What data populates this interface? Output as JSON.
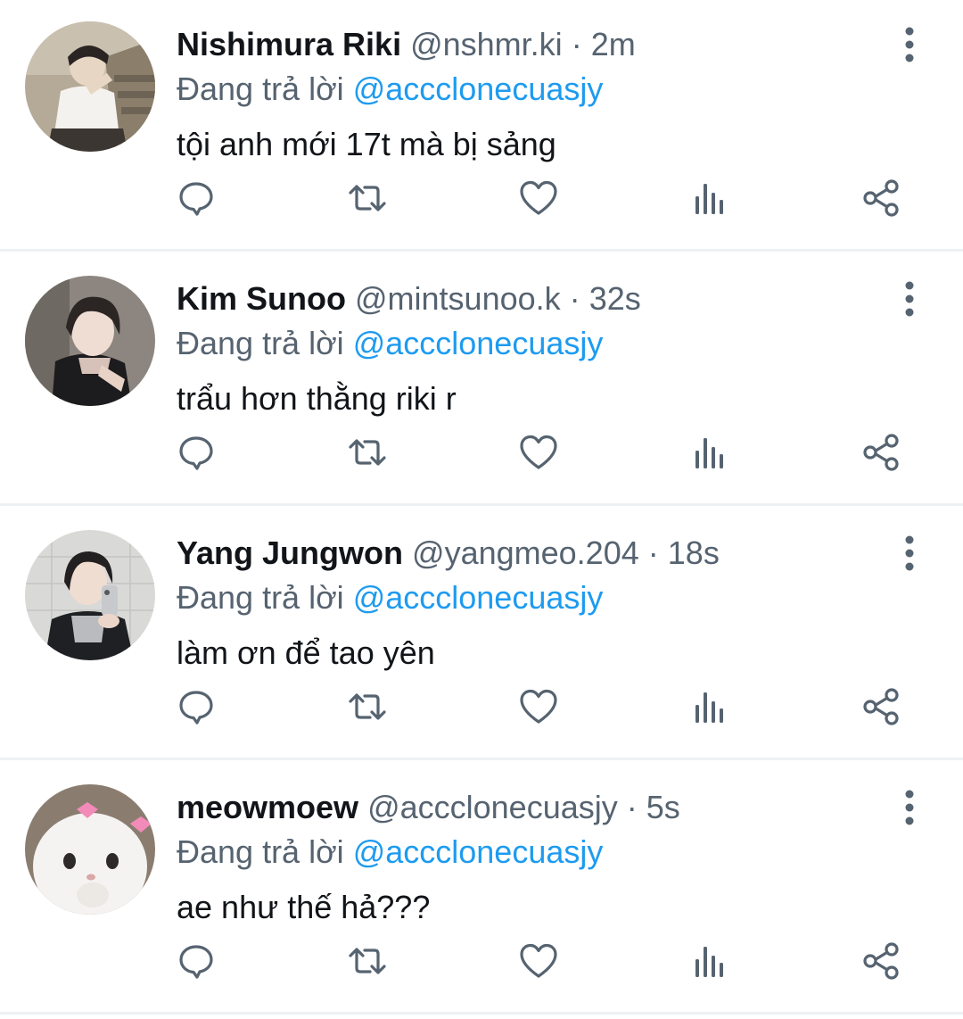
{
  "reply_prefix": "Đang trả lời",
  "colors": {
    "accent": "#1d9bf0",
    "secondary_text": "#566370",
    "icon": "#566370",
    "divider": "#eef1f3"
  },
  "icons": {
    "reply": "speech-bubble-icon",
    "retweet": "retweet-icon",
    "like": "heart-icon",
    "stats": "bar-chart-icon",
    "share": "share-icon",
    "more": "vertical-dots-icon"
  },
  "tweets": [
    {
      "name": "Nishimura Riki",
      "handle": "@nshmr.ki",
      "separator": "·",
      "time": "2m",
      "replying_to": "@accclonecuasjy",
      "text": "tội anh mới 17t mà bị sảng"
    },
    {
      "name": "Kim Sunoo",
      "handle": "@mintsunoo.k",
      "separator": "·",
      "time": "32s",
      "replying_to": "@accclonecuasjy",
      "text": "trẩu hơn thằng riki r"
    },
    {
      "name": "Yang Jungwon",
      "handle": "@yangmeo.204",
      "separator": "·",
      "time": "18s",
      "replying_to": "@accclonecuasjy",
      "text": "làm ơn để tao yên"
    },
    {
      "name": "meowmoew",
      "handle": "@accclonecuasjy",
      "separator": "·",
      "time": "5s",
      "replying_to": "@accclonecuasjy",
      "text": "ae như thế hả???"
    }
  ]
}
